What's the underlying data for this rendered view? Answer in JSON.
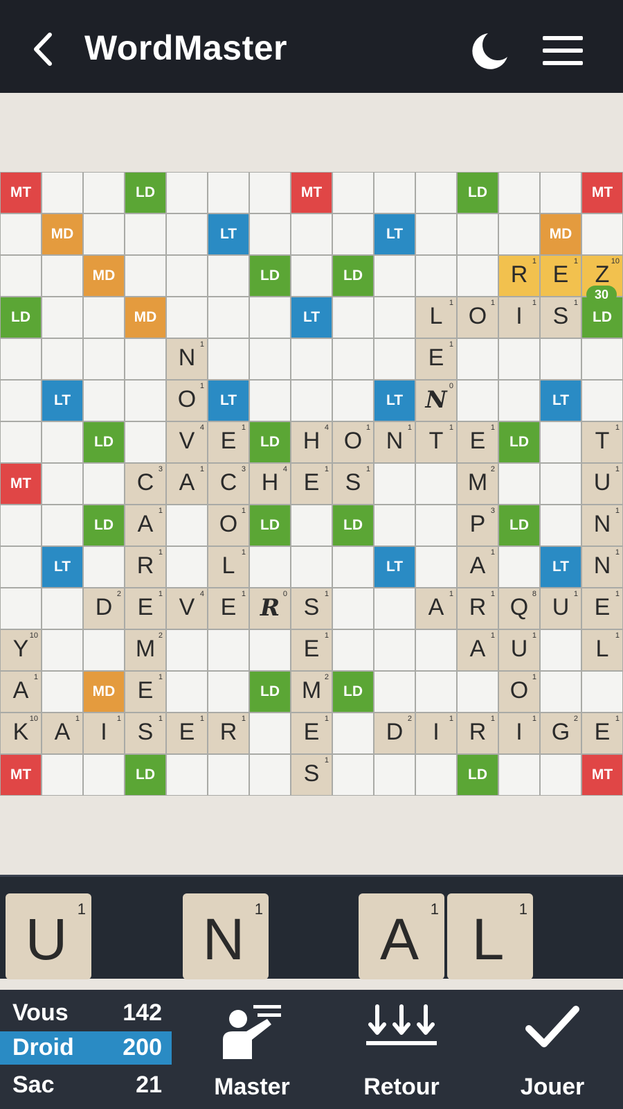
{
  "header": {
    "title": "WordMaster",
    "back_icon": "back-chevron-icon",
    "theme_icon": "moon-icon",
    "menu_icon": "hamburger-menu-icon"
  },
  "board": {
    "colors": {
      "MT": "#e04646",
      "MD": "#e49b3e",
      "LD": "#5ba635",
      "LT": "#2a8bc4",
      "tile": "#dfd3bf",
      "highlight": "#f2c14e"
    },
    "bonus": [
      [
        "MT",
        "",
        "",
        "LD",
        "",
        "",
        "",
        "MT",
        "",
        "",
        "",
        "LD",
        "",
        "",
        "MT"
      ],
      [
        "",
        "MD",
        "",
        "",
        "",
        "LT",
        "",
        "",
        "",
        "LT",
        "",
        "",
        "",
        "MD",
        ""
      ],
      [
        "",
        "",
        "MD",
        "",
        "",
        "",
        "LD",
        "",
        "LD",
        "",
        "",
        "",
        "MD",
        "",
        ""
      ],
      [
        "LD",
        "",
        "",
        "MD",
        "",
        "",
        "",
        "LT",
        "",
        "",
        "",
        "MD",
        "",
        "",
        "LD"
      ],
      [
        "",
        "",
        "",
        "",
        "MD",
        "",
        "",
        "",
        "",
        "",
        "MD",
        "",
        "",
        "",
        ""
      ],
      [
        "",
        "LT",
        "",
        "",
        "",
        "LT",
        "",
        "",
        "",
        "LT",
        "",
        "",
        "",
        "LT",
        ""
      ],
      [
        "",
        "",
        "LD",
        "",
        "",
        "",
        "LD",
        "",
        "LD",
        "",
        "",
        "",
        "LD",
        "",
        ""
      ],
      [
        "MT",
        "",
        "",
        "LD",
        "",
        "",
        "",
        "MD",
        "",
        "",
        "",
        "LD",
        "",
        "",
        "MT"
      ],
      [
        "",
        "",
        "LD",
        "",
        "",
        "",
        "LD",
        "",
        "LD",
        "",
        "",
        "",
        "LD",
        "",
        ""
      ],
      [
        "",
        "LT",
        "",
        "",
        "",
        "LT",
        "",
        "",
        "",
        "LT",
        "",
        "",
        "",
        "LT",
        ""
      ],
      [
        "",
        "",
        "",
        "",
        "MD",
        "",
        "",
        "",
        "",
        "",
        "MD",
        "",
        "",
        "",
        ""
      ],
      [
        "LD",
        "",
        "",
        "MD",
        "",
        "",
        "",
        "LD",
        "",
        "",
        "",
        "MD",
        "",
        "",
        "LD"
      ],
      [
        "",
        "",
        "MD",
        "",
        "",
        "",
        "LD",
        "",
        "LD",
        "",
        "",
        "",
        "MD",
        "",
        ""
      ],
      [
        "",
        "MD",
        "",
        "",
        "",
        "LT",
        "",
        "",
        "",
        "LT",
        "",
        "",
        "",
        "MD",
        ""
      ],
      [
        "MT",
        "",
        "",
        "LD",
        "",
        "",
        "",
        "MT",
        "",
        "",
        "",
        "LD",
        "",
        "",
        "MT"
      ]
    ],
    "tiles": [
      {
        "r": 2,
        "c": 12,
        "l": "R",
        "v": "1",
        "hl": true
      },
      {
        "r": 2,
        "c": 13,
        "l": "E",
        "v": "1",
        "hl": true
      },
      {
        "r": 2,
        "c": 14,
        "l": "Z",
        "v": "10",
        "hl": true
      },
      {
        "r": 3,
        "c": 10,
        "l": "L",
        "v": "1"
      },
      {
        "r": 3,
        "c": 11,
        "l": "O",
        "v": "1"
      },
      {
        "r": 3,
        "c": 12,
        "l": "I",
        "v": "1"
      },
      {
        "r": 3,
        "c": 13,
        "l": "S",
        "v": "1"
      },
      {
        "r": 4,
        "c": 4,
        "l": "N",
        "v": "1"
      },
      {
        "r": 4,
        "c": 10,
        "l": "E",
        "v": "1"
      },
      {
        "r": 5,
        "c": 4,
        "l": "O",
        "v": "1"
      },
      {
        "r": 5,
        "c": 10,
        "l": "N",
        "v": "0",
        "blank": true
      },
      {
        "r": 6,
        "c": 4,
        "l": "V",
        "v": "4"
      },
      {
        "r": 6,
        "c": 5,
        "l": "E",
        "v": "1"
      },
      {
        "r": 6,
        "c": 7,
        "l": "H",
        "v": "4"
      },
      {
        "r": 6,
        "c": 8,
        "l": "O",
        "v": "1"
      },
      {
        "r": 6,
        "c": 9,
        "l": "N",
        "v": "1"
      },
      {
        "r": 6,
        "c": 10,
        "l": "T",
        "v": "1"
      },
      {
        "r": 6,
        "c": 11,
        "l": "E",
        "v": "1"
      },
      {
        "r": 6,
        "c": 14,
        "l": "T",
        "v": "1"
      },
      {
        "r": 7,
        "c": 3,
        "l": "C",
        "v": "3"
      },
      {
        "r": 7,
        "c": 4,
        "l": "A",
        "v": "1"
      },
      {
        "r": 7,
        "c": 5,
        "l": "C",
        "v": "3"
      },
      {
        "r": 7,
        "c": 6,
        "l": "H",
        "v": "4"
      },
      {
        "r": 7,
        "c": 7,
        "l": "E",
        "v": "1"
      },
      {
        "r": 7,
        "c": 8,
        "l": "S",
        "v": "1"
      },
      {
        "r": 7,
        "c": 11,
        "l": "M",
        "v": "2"
      },
      {
        "r": 7,
        "c": 14,
        "l": "U",
        "v": "1"
      },
      {
        "r": 8,
        "c": 3,
        "l": "A",
        "v": "1"
      },
      {
        "r": 8,
        "c": 5,
        "l": "O",
        "v": "1"
      },
      {
        "r": 8,
        "c": 11,
        "l": "P",
        "v": "3"
      },
      {
        "r": 8,
        "c": 14,
        "l": "N",
        "v": "1"
      },
      {
        "r": 9,
        "c": 3,
        "l": "R",
        "v": "1"
      },
      {
        "r": 9,
        "c": 5,
        "l": "L",
        "v": "1"
      },
      {
        "r": 9,
        "c": 11,
        "l": "A",
        "v": "1"
      },
      {
        "r": 9,
        "c": 14,
        "l": "N",
        "v": "1"
      },
      {
        "r": 10,
        "c": 2,
        "l": "D",
        "v": "2"
      },
      {
        "r": 10,
        "c": 3,
        "l": "E",
        "v": "1"
      },
      {
        "r": 10,
        "c": 4,
        "l": "V",
        "v": "4"
      },
      {
        "r": 10,
        "c": 5,
        "l": "E",
        "v": "1"
      },
      {
        "r": 10,
        "c": 6,
        "l": "R",
        "v": "0",
        "blank": true
      },
      {
        "r": 10,
        "c": 7,
        "l": "S",
        "v": "1"
      },
      {
        "r": 10,
        "c": 10,
        "l": "A",
        "v": "1"
      },
      {
        "r": 10,
        "c": 11,
        "l": "R",
        "v": "1"
      },
      {
        "r": 10,
        "c": 12,
        "l": "Q",
        "v": "8"
      },
      {
        "r": 10,
        "c": 13,
        "l": "U",
        "v": "1"
      },
      {
        "r": 10,
        "c": 14,
        "l": "E",
        "v": "1"
      },
      {
        "r": 11,
        "c": 0,
        "l": "Y",
        "v": "10"
      },
      {
        "r": 11,
        "c": 3,
        "l": "M",
        "v": "2"
      },
      {
        "r": 11,
        "c": 7,
        "l": "E",
        "v": "1"
      },
      {
        "r": 11,
        "c": 11,
        "l": "A",
        "v": "1"
      },
      {
        "r": 11,
        "c": 12,
        "l": "U",
        "v": "1"
      },
      {
        "r": 11,
        "c": 14,
        "l": "L",
        "v": "1"
      },
      {
        "r": 12,
        "c": 0,
        "l": "A",
        "v": "1"
      },
      {
        "r": 12,
        "c": 3,
        "l": "E",
        "v": "1"
      },
      {
        "r": 12,
        "c": 7,
        "l": "M",
        "v": "2"
      },
      {
        "r": 12,
        "c": 12,
        "l": "O",
        "v": "1"
      },
      {
        "r": 13,
        "c": 0,
        "l": "K",
        "v": "10"
      },
      {
        "r": 13,
        "c": 1,
        "l": "A",
        "v": "1"
      },
      {
        "r": 13,
        "c": 2,
        "l": "I",
        "v": "1"
      },
      {
        "r": 13,
        "c": 3,
        "l": "S",
        "v": "1"
      },
      {
        "r": 13,
        "c": 4,
        "l": "E",
        "v": "1"
      },
      {
        "r": 13,
        "c": 5,
        "l": "R",
        "v": "1"
      },
      {
        "r": 13,
        "c": 7,
        "l": "E",
        "v": "1"
      },
      {
        "r": 13,
        "c": 9,
        "l": "D",
        "v": "2"
      },
      {
        "r": 13,
        "c": 10,
        "l": "I",
        "v": "1"
      },
      {
        "r": 13,
        "c": 11,
        "l": "R",
        "v": "1"
      },
      {
        "r": 13,
        "c": 12,
        "l": "I",
        "v": "1"
      },
      {
        "r": 13,
        "c": 13,
        "l": "G",
        "v": "2"
      },
      {
        "r": 13,
        "c": 14,
        "l": "E",
        "v": "1"
      },
      {
        "r": 14,
        "c": 7,
        "l": "S",
        "v": "1"
      }
    ],
    "move_score": {
      "r": 2,
      "c": 14,
      "value": "30"
    }
  },
  "rack": [
    {
      "slot": 0,
      "l": "U",
      "v": "1"
    },
    {
      "slot": 2,
      "l": "N",
      "v": "1"
    },
    {
      "slot": 4,
      "l": "A",
      "v": "1"
    },
    {
      "slot": 5,
      "l": "L",
      "v": "1"
    }
  ],
  "scores": {
    "you_label": "Vous",
    "you_score": "142",
    "droid_label": "Droid",
    "droid_score": "200",
    "bag_label": "Sac",
    "bag_count": "21"
  },
  "actions": {
    "master_label": "Master",
    "master_icon": "master-teacher-icon",
    "retour_label": "Retour",
    "retour_icon": "return-tiles-icon",
    "jouer_label": "Jouer",
    "jouer_icon": "checkmark-icon"
  }
}
